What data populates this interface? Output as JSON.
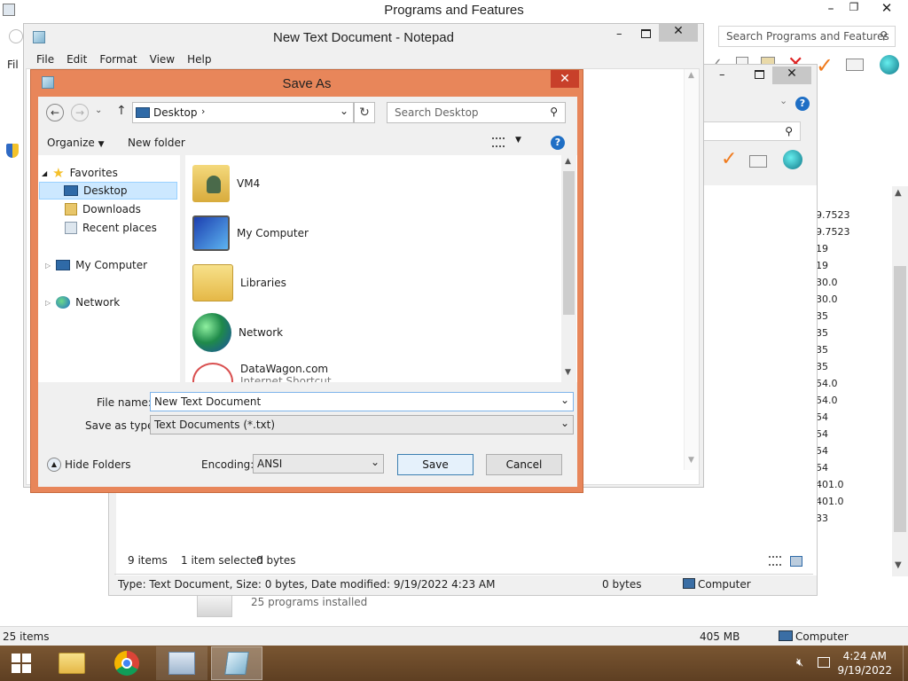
{
  "programs": {
    "title": "Programs and Features",
    "search_placeholder": "Search Programs and Features",
    "status_items": "25 items",
    "status_size": "405 MB",
    "status_location": "Computer",
    "installed_count": "25 programs installed",
    "version_values": [
      "9.7523",
      "9.7523",
      "19",
      "19",
      "30.0",
      "30.0",
      "35",
      "35",
      "35",
      "35",
      "54.0",
      "54.0",
      "54",
      "54",
      "54",
      "54",
      "401.0",
      "401.0",
      "33"
    ]
  },
  "explorer": {
    "status_items": "9 items",
    "status_selected": "1 item selected",
    "status_bytes": "0 bytes",
    "details_text": "Type: Text Document, Size: 0 bytes, Date modified: 9/19/2022 4:23 AM",
    "details_size": "0 bytes",
    "details_location": "Computer"
  },
  "notepad": {
    "title": "New Text Document - Notepad",
    "menu": [
      "File",
      "Edit",
      "Format",
      "View",
      "Help"
    ]
  },
  "saveas": {
    "title": "Save As",
    "location": "Desktop",
    "search_placeholder": "Search Desktop",
    "organize_label": "Organize",
    "new_folder_label": "New folder",
    "tree": {
      "favorites": "Favorites",
      "desktop": "Desktop",
      "downloads": "Downloads",
      "recent": "Recent places",
      "computer": "My Computer",
      "network": "Network"
    },
    "files": [
      {
        "name": "VM4",
        "sub": ""
      },
      {
        "name": "My Computer",
        "sub": ""
      },
      {
        "name": "Libraries",
        "sub": ""
      },
      {
        "name": "Network",
        "sub": ""
      },
      {
        "name": "DataWagon.com",
        "sub": "Internet Shortcut"
      }
    ],
    "filename_label": "File name:",
    "filename_value": "New Text Document",
    "type_label": "Save as type:",
    "type_value": "Text Documents (*.txt)",
    "hide_folders_label": "Hide Folders",
    "encoding_label": "Encoding:",
    "encoding_value": "ANSI",
    "save_label": "Save",
    "cancel_label": "Cancel"
  },
  "taskbar": {
    "time": "4:24 AM",
    "date": "9/19/2022"
  },
  "colors": {
    "dialog_frame": "#e8865a",
    "selection": "#cce8ff",
    "taskbar": "#6b4a2a"
  }
}
